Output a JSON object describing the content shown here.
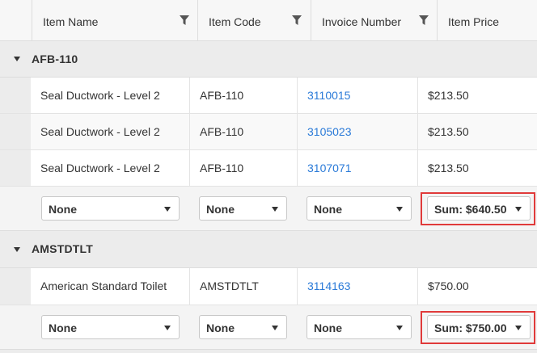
{
  "columns": [
    {
      "label": "Item Name",
      "filter_icon": "funnel-filter-icon"
    },
    {
      "label": "Item Code",
      "filter_icon": "funnel-filter-icon"
    },
    {
      "label": "Invoice Number",
      "filter_icon": "funnel-filter-icon"
    },
    {
      "label": "Item Price"
    }
  ],
  "groups": [
    {
      "name": "AFB-110",
      "rows": [
        {
          "item_name": "Seal Ductwork - Level 2",
          "item_code": "AFB-110",
          "invoice_number": "3110015",
          "item_price": "$213.50"
        },
        {
          "item_name": "Seal Ductwork - Level 2",
          "item_code": "AFB-110",
          "invoice_number": "3105023",
          "item_price": "$213.50"
        },
        {
          "item_name": "Seal Ductwork - Level 2",
          "item_code": "AFB-110",
          "invoice_number": "3107071",
          "item_price": "$213.50"
        }
      ],
      "summary": {
        "item_name": "None",
        "item_code": "None",
        "invoice_number": "None",
        "item_price": "Sum: $640.50"
      }
    },
    {
      "name": "AMSTDTLT",
      "rows": [
        {
          "item_name": "American Standard Toilet",
          "item_code": "AMSTDTLT",
          "invoice_number": "3114163",
          "item_price": "$750.00"
        }
      ],
      "summary": {
        "item_name": "None",
        "item_code": "None",
        "invoice_number": "None",
        "item_price": "Sum: $750.00"
      }
    }
  ],
  "colors": {
    "link": "#2a7ad8",
    "highlight": "#e03a3a",
    "group_bg": "#ececec"
  },
  "icons": {
    "group_toggle": "caret-down-icon",
    "dropdown": "chevron-down-icon"
  }
}
